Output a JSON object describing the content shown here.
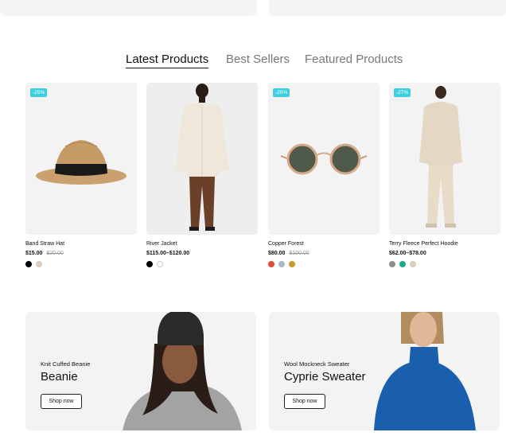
{
  "tabs": [
    {
      "label": "Latest Products"
    },
    {
      "label": "Best Sellers"
    },
    {
      "label": "Featured Products"
    }
  ],
  "products": [
    {
      "name": "Band Straw Hat",
      "price": "$15.00",
      "old_price": "$20.00",
      "badge": "-25%",
      "swatches": [
        "#000000",
        "#e8cdb3"
      ]
    },
    {
      "name": "River Jacket",
      "price": "$115.00–$120.00",
      "old_price": "",
      "badge": "",
      "swatches": [
        "#000000",
        "#ffffff"
      ]
    },
    {
      "name": "Copper Forest",
      "price": "$80.00",
      "old_price": "$100.00",
      "badge": "-20%",
      "swatches": [
        "#e24a3b",
        "#a9b7cc",
        "#c99b2c"
      ]
    },
    {
      "name": "Terry Fleece Perfect Hoodie",
      "price": "$62.00–$78.00",
      "old_price": "",
      "badge": "-27%",
      "swatches": [
        "#8d8d8d",
        "#1aa98a",
        "#e8cdb3"
      ]
    }
  ],
  "banners": [
    {
      "subtitle": "Knit Cuffed Beanie",
      "title": "Beanie",
      "button": "Shop now"
    },
    {
      "subtitle": "Wool Mockneck Sweater",
      "title": "Cyprie Sweater",
      "button": "Shop now"
    }
  ],
  "colors": {
    "badge": "#3fd0e0",
    "sweater_blue": "#1a5fae"
  }
}
